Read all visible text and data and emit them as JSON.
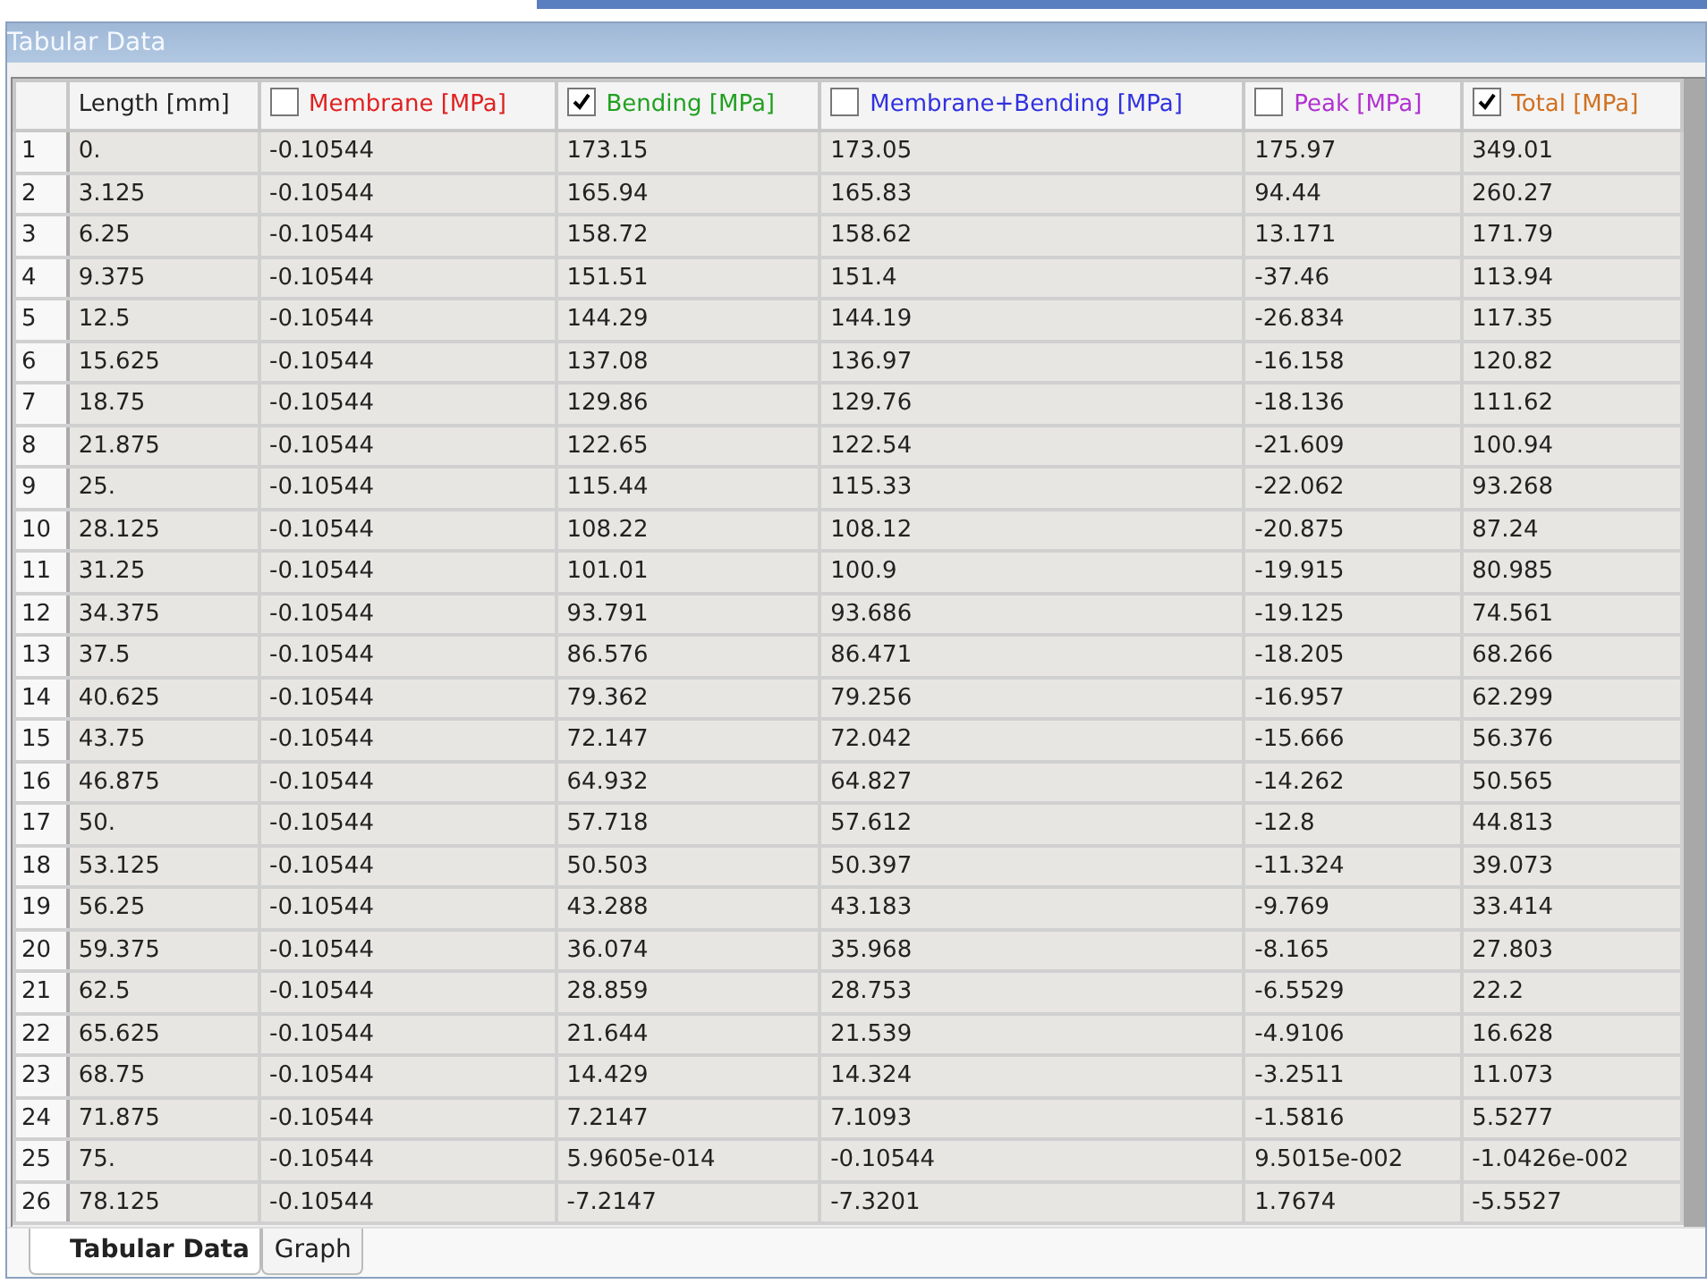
{
  "window": {
    "title": "Tabular Data"
  },
  "table": {
    "columns": [
      {
        "kind": "plain",
        "label": "Length [mm]",
        "color": "#222222"
      },
      {
        "kind": "checkbox",
        "label": "Membrane [MPa]",
        "color": "#e02020",
        "checked": false
      },
      {
        "kind": "checkbox",
        "label": "Bending [MPa]",
        "color": "#20a020",
        "checked": true
      },
      {
        "kind": "checkbox",
        "label": "Membrane+Bending [MPa]",
        "color": "#3030e0",
        "checked": false
      },
      {
        "kind": "checkbox",
        "label": "Peak [MPa]",
        "color": "#b030d0",
        "checked": false
      },
      {
        "kind": "checkbox",
        "label": "Total [MPa]",
        "color": "#d07020",
        "checked": true
      }
    ],
    "rows": [
      {
        "number": "1",
        "cells": [
          "0.",
          "-0.10544",
          "173.15",
          "173.05",
          "175.97",
          "349.01"
        ]
      },
      {
        "number": "2",
        "cells": [
          "3.125",
          "-0.10544",
          "165.94",
          "165.83",
          "94.44",
          "260.27"
        ]
      },
      {
        "number": "3",
        "cells": [
          "6.25",
          "-0.10544",
          "158.72",
          "158.62",
          "13.171",
          "171.79"
        ]
      },
      {
        "number": "4",
        "cells": [
          "9.375",
          "-0.10544",
          "151.51",
          "151.4",
          "-37.46",
          "113.94"
        ]
      },
      {
        "number": "5",
        "cells": [
          "12.5",
          "-0.10544",
          "144.29",
          "144.19",
          "-26.834",
          "117.35"
        ]
      },
      {
        "number": "6",
        "cells": [
          "15.625",
          "-0.10544",
          "137.08",
          "136.97",
          "-16.158",
          "120.82"
        ]
      },
      {
        "number": "7",
        "cells": [
          "18.75",
          "-0.10544",
          "129.86",
          "129.76",
          "-18.136",
          "111.62"
        ]
      },
      {
        "number": "8",
        "cells": [
          "21.875",
          "-0.10544",
          "122.65",
          "122.54",
          "-21.609",
          "100.94"
        ]
      },
      {
        "number": "9",
        "cells": [
          "25.",
          "-0.10544",
          "115.44",
          "115.33",
          "-22.062",
          "93.268"
        ]
      },
      {
        "number": "10",
        "cells": [
          "28.125",
          "-0.10544",
          "108.22",
          "108.12",
          "-20.875",
          "87.24"
        ]
      },
      {
        "number": "11",
        "cells": [
          "31.25",
          "-0.10544",
          "101.01",
          "100.9",
          "-19.915",
          "80.985"
        ]
      },
      {
        "number": "12",
        "cells": [
          "34.375",
          "-0.10544",
          "93.791",
          "93.686",
          "-19.125",
          "74.561"
        ]
      },
      {
        "number": "13",
        "cells": [
          "37.5",
          "-0.10544",
          "86.576",
          "86.471",
          "-18.205",
          "68.266"
        ]
      },
      {
        "number": "14",
        "cells": [
          "40.625",
          "-0.10544",
          "79.362",
          "79.256",
          "-16.957",
          "62.299"
        ]
      },
      {
        "number": "15",
        "cells": [
          "43.75",
          "-0.10544",
          "72.147",
          "72.042",
          "-15.666",
          "56.376"
        ]
      },
      {
        "number": "16",
        "cells": [
          "46.875",
          "-0.10544",
          "64.932",
          "64.827",
          "-14.262",
          "50.565"
        ]
      },
      {
        "number": "17",
        "cells": [
          "50.",
          "-0.10544",
          "57.718",
          "57.612",
          "-12.8",
          "44.813"
        ]
      },
      {
        "number": "18",
        "cells": [
          "53.125",
          "-0.10544",
          "50.503",
          "50.397",
          "-11.324",
          "39.073"
        ]
      },
      {
        "number": "19",
        "cells": [
          "56.25",
          "-0.10544",
          "43.288",
          "43.183",
          "-9.769",
          "33.414"
        ]
      },
      {
        "number": "20",
        "cells": [
          "59.375",
          "-0.10544",
          "36.074",
          "35.968",
          "-8.165",
          "27.803"
        ]
      },
      {
        "number": "21",
        "cells": [
          "62.5",
          "-0.10544",
          "28.859",
          "28.753",
          "-6.5529",
          "22.2"
        ]
      },
      {
        "number": "22",
        "cells": [
          "65.625",
          "-0.10544",
          "21.644",
          "21.539",
          "-4.9106",
          "16.628"
        ]
      },
      {
        "number": "23",
        "cells": [
          "68.75",
          "-0.10544",
          "14.429",
          "14.324",
          "-3.2511",
          "11.073"
        ]
      },
      {
        "number": "24",
        "cells": [
          "71.875",
          "-0.10544",
          "7.2147",
          "7.1093",
          "-1.5816",
          "5.5277"
        ]
      },
      {
        "number": "25",
        "cells": [
          "75.",
          "-0.10544",
          "5.9605e-014",
          "-0.10544",
          "9.5015e-002",
          "-1.0426e-002"
        ]
      },
      {
        "number": "26",
        "cells": [
          "78.125",
          "-0.10544",
          "-7.2147",
          "-7.3201",
          "1.7674",
          "-5.5527"
        ]
      }
    ]
  },
  "tabs": [
    {
      "label": "Tabular Data",
      "selected": true
    },
    {
      "label": "Graph",
      "selected": false
    }
  ]
}
